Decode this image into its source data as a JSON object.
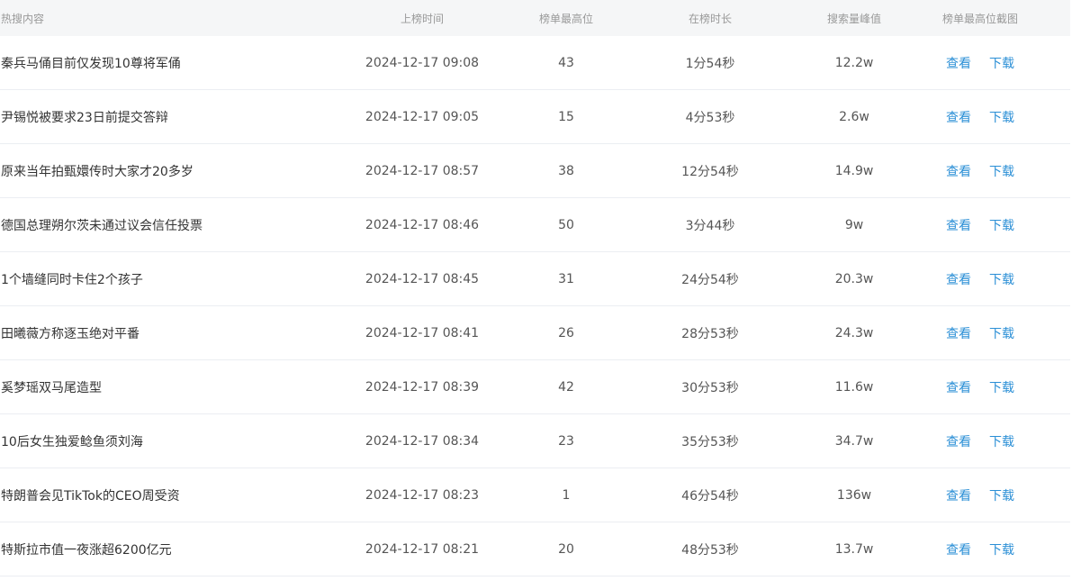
{
  "header": {
    "content": "热搜内容",
    "time": "上榜时间",
    "rank": "榜单最高位",
    "duration": "在榜时长",
    "peak": "搜索量峰值",
    "screenshot": "榜单最高位截图"
  },
  "actions": {
    "view": "查看",
    "download": "下载"
  },
  "colors": {
    "link": "#2b8fd6",
    "header_bg": "#f5f6f7",
    "row_border": "#ebeef2"
  },
  "rows": [
    {
      "content": "秦兵马俑目前仅发现10尊将军俑",
      "time": "2024-12-17 09:08",
      "rank": "43",
      "duration": "1分54秒",
      "peak": "12.2w"
    },
    {
      "content": "尹锡悦被要求23日前提交答辩",
      "time": "2024-12-17 09:05",
      "rank": "15",
      "duration": "4分53秒",
      "peak": "2.6w"
    },
    {
      "content": "原来当年拍甄嬛传时大家才20多岁",
      "time": "2024-12-17 08:57",
      "rank": "38",
      "duration": "12分54秒",
      "peak": "14.9w"
    },
    {
      "content": "德国总理朔尔茨未通过议会信任投票",
      "time": "2024-12-17 08:46",
      "rank": "50",
      "duration": "3分44秒",
      "peak": "9w"
    },
    {
      "content": "1个墙缝同时卡住2个孩子",
      "time": "2024-12-17 08:45",
      "rank": "31",
      "duration": "24分54秒",
      "peak": "20.3w"
    },
    {
      "content": "田曦薇方称逐玉绝对平番",
      "time": "2024-12-17 08:41",
      "rank": "26",
      "duration": "28分53秒",
      "peak": "24.3w"
    },
    {
      "content": "奚梦瑶双马尾造型",
      "time": "2024-12-17 08:39",
      "rank": "42",
      "duration": "30分53秒",
      "peak": "11.6w"
    },
    {
      "content": "10后女生独爱鲶鱼须刘海",
      "time": "2024-12-17 08:34",
      "rank": "23",
      "duration": "35分53秒",
      "peak": "34.7w"
    },
    {
      "content": "特朗普会见TikTok的CEO周受资",
      "time": "2024-12-17 08:23",
      "rank": "1",
      "duration": "46分54秒",
      "peak": "136w"
    },
    {
      "content": "特斯拉市值一夜涨超6200亿元",
      "time": "2024-12-17 08:21",
      "rank": "20",
      "duration": "48分53秒",
      "peak": "13.7w"
    }
  ]
}
